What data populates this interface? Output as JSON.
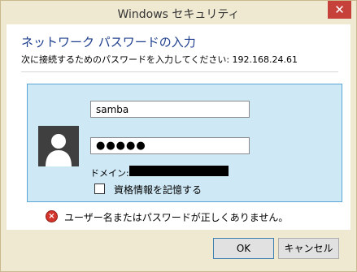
{
  "window": {
    "title": "Windows セキュリティ",
    "close_glyph": "✕",
    "accent_color": "#1f3f8f",
    "frame_color": "#f0e9d2"
  },
  "header": {
    "heading": "ネットワーク パスワードの入力",
    "subheading": "次に接続するためのパスワードを入力してください: 192.168.24.61"
  },
  "credentials": {
    "avatar_icon": "user-avatar-icon",
    "username_value": "samba",
    "password_masked": "●●●●●",
    "domain_label": "ドメイン:",
    "domain_value_redacted": true,
    "remember_label": "資格情報を記憶する",
    "remember_checked": false
  },
  "error": {
    "icon": "error-x-icon",
    "message": "ユーザー名またはパスワードが正しくありません。"
  },
  "buttons": {
    "ok_label": "OK",
    "cancel_label": "キャンセル"
  }
}
